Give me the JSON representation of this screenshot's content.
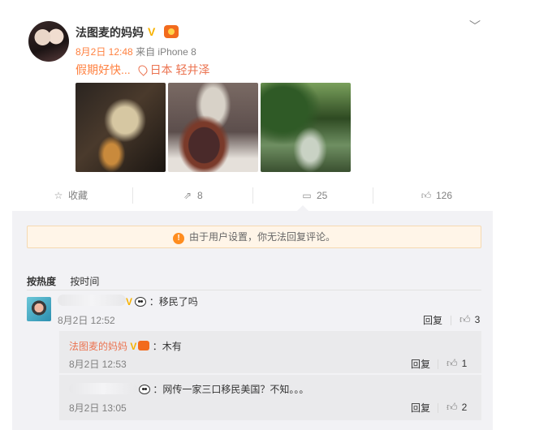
{
  "post": {
    "username": "法图麦的妈妈",
    "verified_badge": "V",
    "date": "8月2日 12:48",
    "source": "来自 iPhone 8",
    "text": "假期好快...",
    "location": "日本 轻井泽",
    "photos": [
      "food-dish-photo",
      "restaurant-table-photo",
      "forest-stream-photo"
    ]
  },
  "actions": {
    "favorite": "收藏",
    "repost": "8",
    "comment": "25",
    "like": "126"
  },
  "comments_section": {
    "notice": "由于用户设置，你无法回复评论。",
    "sort_hot": "按热度",
    "sort_time": "按时间"
  },
  "comments": [
    {
      "text": "：移民了吗",
      "date": "8月2日 12:52",
      "reply_label": "回复",
      "likes": "3"
    }
  ],
  "replies": [
    {
      "author": "法图麦的妈妈",
      "text": "：木有",
      "date": "8月2日 12:53",
      "reply_label": "回复",
      "likes": "1"
    },
    {
      "text": "：网传一家三口移民美国？不知。。。",
      "date": "8月2日 13:05",
      "reply_label": "回复",
      "likes": "2"
    }
  ],
  "colors": {
    "accent": "#ff8140",
    "link": "#eb7350",
    "verified": "#f7b200",
    "comment_bg": "#f2f2f5",
    "notice_bg": "#fff5e8"
  }
}
